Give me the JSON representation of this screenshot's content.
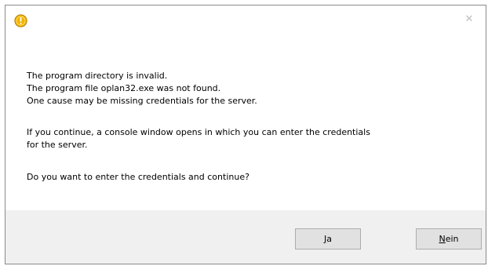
{
  "dialog": {
    "close_glyph": "✕",
    "title_icon": "warning-circle-icon",
    "colors": {
      "icon_fill": "#f4b400",
      "icon_stroke": "#b07d00",
      "footer_bg": "#f0f0f0",
      "button_bg": "#e1e1e1",
      "button_border": "#adadad"
    }
  },
  "message": {
    "line1": "The program directory is invalid.",
    "line2": "The program file oplan32.exe was not found.",
    "line3": "One cause may be missing credentials for the server.",
    "line4": "If you continue, a console window opens in which you can enter the credentials",
    "line5": "for the server.",
    "line6": "Do you want to enter the credentials and continue?"
  },
  "buttons": {
    "yes": {
      "mnemonic": "J",
      "rest": "a"
    },
    "no": {
      "mnemonic": "N",
      "rest": "ein"
    }
  }
}
